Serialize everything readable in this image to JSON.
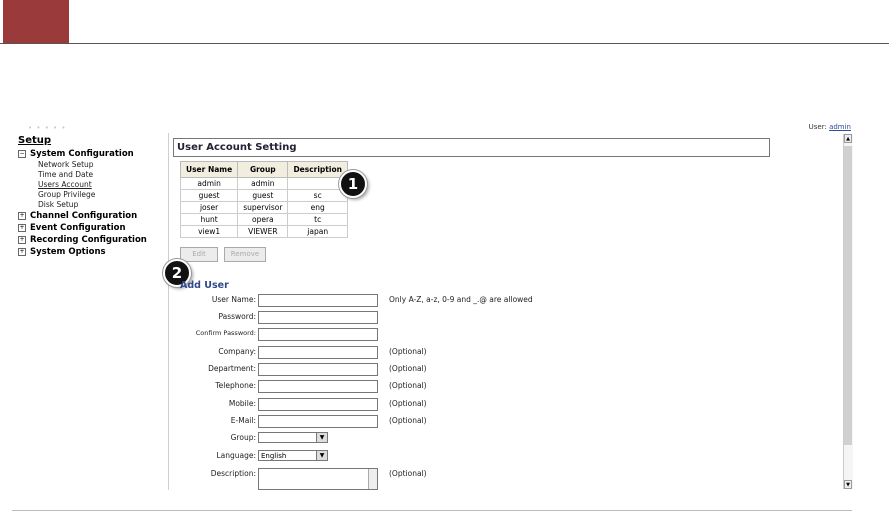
{
  "sidebar": {
    "setup_label": "Setup",
    "sections": [
      {
        "label": "System Configuration",
        "marker": "−",
        "items": [
          "Network Setup",
          "Time and Date",
          "Users Account",
          "Group Privilege",
          "Disk Setup"
        ]
      },
      {
        "label": "Channel Configuration",
        "marker": "+"
      },
      {
        "label": "Event Configuration",
        "marker": "+"
      },
      {
        "label": "Recording Configuration",
        "marker": "+"
      },
      {
        "label": "System Options",
        "marker": "+"
      }
    ]
  },
  "main": {
    "title": "User Account Setting",
    "table": {
      "headers": [
        "User Name",
        "Group",
        "Description"
      ],
      "rows": [
        [
          "admin",
          "admin",
          ""
        ],
        [
          "guest",
          "guest",
          "sc"
        ],
        [
          "joser",
          "supervisor",
          "eng"
        ],
        [
          "hunt",
          "opera",
          "tc"
        ],
        [
          "view1",
          "VIEWER",
          "japan"
        ]
      ]
    },
    "buttons": {
      "edit": "Edit",
      "remove": "Remove"
    },
    "callouts": {
      "first": "1",
      "second": "2"
    },
    "add_user": {
      "title": "Add User",
      "fields": {
        "user_name": {
          "label": "User Name:",
          "note": "Only A-Z, a-z, 0-9 and _.@ are allowed"
        },
        "password": {
          "label": "Password:"
        },
        "confirm_password": {
          "label": "Confirm Password:"
        },
        "company": {
          "label": "Company:",
          "note": "(Optional)"
        },
        "department": {
          "label": "Department:",
          "note": "(Optional)"
        },
        "telephone": {
          "label": "Telephone:",
          "note": "(Optional)"
        },
        "mobile": {
          "label": "Mobile:",
          "note": "(Optional)"
        },
        "email": {
          "label": "E-Mail:",
          "note": "(Optional)"
        },
        "group": {
          "label": "Group:",
          "value": ""
        },
        "language": {
          "label": "Language:",
          "value": "English"
        },
        "description": {
          "label": "Description:",
          "note": "(Optional)"
        }
      }
    }
  },
  "colors": {
    "header_accent": "#9b3a3a",
    "section_title": "#2f4a8c"
  }
}
